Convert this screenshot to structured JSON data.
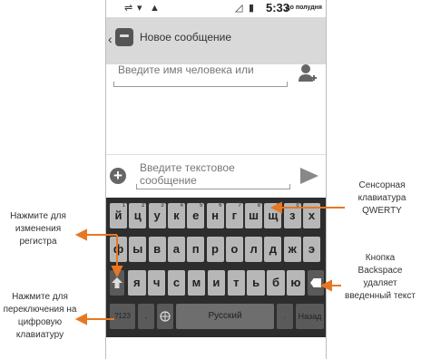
{
  "status_bar": {
    "time": "5:33",
    "ampm": "до полудня",
    "icons": [
      "usb-icon",
      "wifi-icon",
      "warning-icon",
      "signal-icon",
      "battery-icon"
    ]
  },
  "action_bar": {
    "title": "Новое сообщение",
    "icon": "messaging-icon"
  },
  "recipient": {
    "placeholder": "Введите имя человека или"
  },
  "compose": {
    "placeholder": "Введите текстовое сообщение"
  },
  "keyboard": {
    "row1": [
      {
        "label": "й",
        "hint": "1"
      },
      {
        "label": "ц",
        "hint": "2"
      },
      {
        "label": "у",
        "hint": "3"
      },
      {
        "label": "к",
        "hint": "4"
      },
      {
        "label": "е",
        "hint": "5"
      },
      {
        "label": "н",
        "hint": "6"
      },
      {
        "label": "г",
        "hint": "7"
      },
      {
        "label": "ш",
        "hint": "8"
      },
      {
        "label": "щ",
        "hint": "9"
      },
      {
        "label": "з",
        "hint": "0"
      },
      {
        "label": "х",
        "hint": ""
      }
    ],
    "row2": [
      "ф",
      "ы",
      "в",
      "а",
      "п",
      "р",
      "о",
      "л",
      "д",
      "ж",
      "э"
    ],
    "row3": [
      "я",
      "ч",
      "с",
      "м",
      "и",
      "т",
      "ь",
      "б",
      "ю"
    ],
    "sym_label": "?123",
    "comma_label": ",",
    "space_label": "Русский",
    "period_label": ".",
    "next_label": "Назад"
  },
  "callouts": {
    "qwerty": "Сенсорная клавиатура QWERTY",
    "shift": "Нажмите для изменения регистра",
    "backspace": "Кнопка Backspace удаляет введенный текст",
    "numeric": "Нажмите для переключения на цифровую клавиатуру"
  },
  "colors": {
    "accent": "#e87722",
    "keyboard_bg": "#2d2d2d",
    "key": "#b7b7b7",
    "action_bar": "#d9d9d9"
  }
}
